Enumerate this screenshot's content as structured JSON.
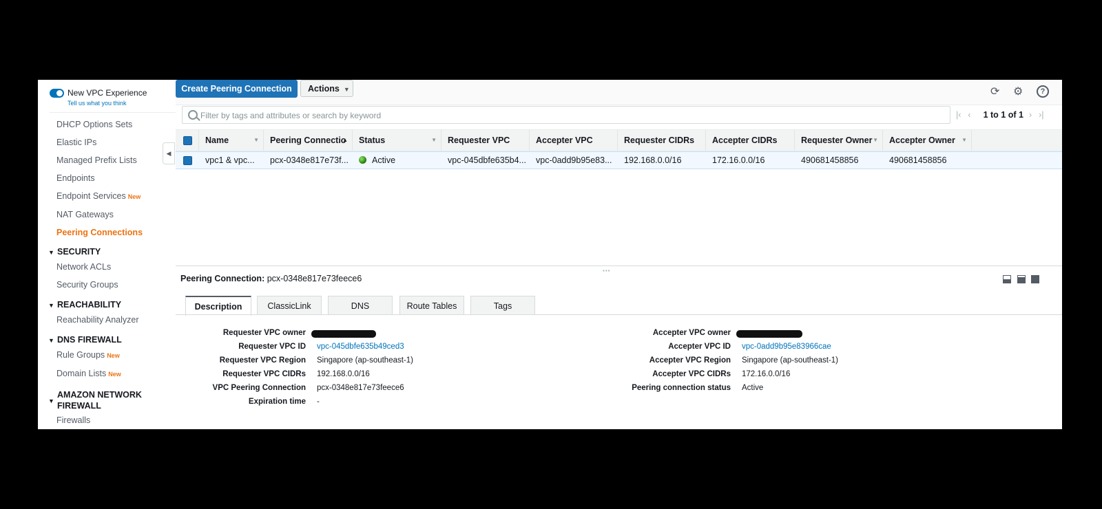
{
  "sidebar": {
    "toggle_label": "New VPC Experience",
    "feedback_link": "Tell us what you think",
    "items": [
      {
        "label": "DHCP Options Sets",
        "new": ""
      },
      {
        "label": "Elastic IPs",
        "new": ""
      },
      {
        "label": "Managed Prefix Lists",
        "new": ""
      },
      {
        "label": "Endpoints",
        "new": ""
      },
      {
        "label": "Endpoint Services",
        "new": "New"
      },
      {
        "label": "NAT Gateways",
        "new": ""
      },
      {
        "label": "Peering Connections",
        "new": "",
        "active": true
      }
    ],
    "security": {
      "title": "SECURITY",
      "items": [
        "Network ACLs",
        "Security Groups"
      ]
    },
    "reachability": {
      "title": "REACHABILITY",
      "items": [
        "Reachability Analyzer"
      ]
    },
    "dns_firewall": {
      "title": "DNS FIREWALL",
      "items": [
        {
          "label": "Rule Groups",
          "new": "New"
        },
        {
          "label": "Domain Lists",
          "new": "New"
        }
      ]
    },
    "network_firewall": {
      "title_line1": "AMAZON NETWORK",
      "title_line2": "FIREWALL",
      "items": [
        "Firewalls"
      ]
    },
    "new_badge": "New"
  },
  "toolbar": {
    "create_label": "Create Peering Connection",
    "actions_label": "Actions",
    "icons": [
      "refresh-icon",
      "settings-icon",
      "help-icon"
    ]
  },
  "search": {
    "placeholder": "Filter by tags and attributes or search by keyword"
  },
  "pager": {
    "text": "1 to 1 of 1"
  },
  "table": {
    "columns": [
      "Name",
      "Peering Connectio",
      "Status",
      "Requester VPC",
      "Accepter VPC",
      "Requester CIDRs",
      "Accepter CIDRs",
      "Requester Owner",
      "Accepter Owner"
    ],
    "rows": [
      {
        "name": "vpc1 & vpc...",
        "peering_connection": "pcx-0348e817e73f...",
        "status": "Active",
        "requester_vpc": "vpc-045dbfe635b4...",
        "accepter_vpc": "vpc-0add9b95e83...",
        "requester_cidrs": "192.168.0.0/16",
        "accepter_cidrs": "172.16.0.0/16",
        "requester_owner": "490681458856",
        "accepter_owner": "490681458856"
      }
    ]
  },
  "details": {
    "title_label": "Peering Connection:",
    "title_value": "pcx-0348e817e73feece6",
    "tabs": [
      "Description",
      "ClassicLink",
      "DNS",
      "Route Tables",
      "Tags"
    ],
    "left": [
      {
        "label": "Requester VPC owner",
        "value": ""
      },
      {
        "label": "Requester VPC ID",
        "value": "vpc-045dbfe635b49ced3"
      },
      {
        "label": "Requester VPC Region",
        "value": "Singapore (ap-southeast-1)"
      },
      {
        "label": "Requester VPC CIDRs",
        "value": "192.168.0.0/16"
      },
      {
        "label": "VPC Peering Connection",
        "value": "pcx-0348e817e73feece6"
      },
      {
        "label": "Expiration time",
        "value": "-"
      }
    ],
    "right": [
      {
        "label": "Accepter VPC owner",
        "value": ""
      },
      {
        "label": "Accepter VPC ID",
        "value": "vpc-0add9b95e83966cae"
      },
      {
        "label": "Accepter VPC Region",
        "value": "Singapore (ap-southeast-1)"
      },
      {
        "label": "Accepter VPC CIDRs",
        "value": "172.16.0.0/16"
      },
      {
        "label": "Peering connection status",
        "value": "Active"
      }
    ]
  },
  "colors": {
    "accent": "#1f73b7",
    "active_nav": "#ec7211",
    "status_active": "#1d8102",
    "link": "#0073bb"
  }
}
